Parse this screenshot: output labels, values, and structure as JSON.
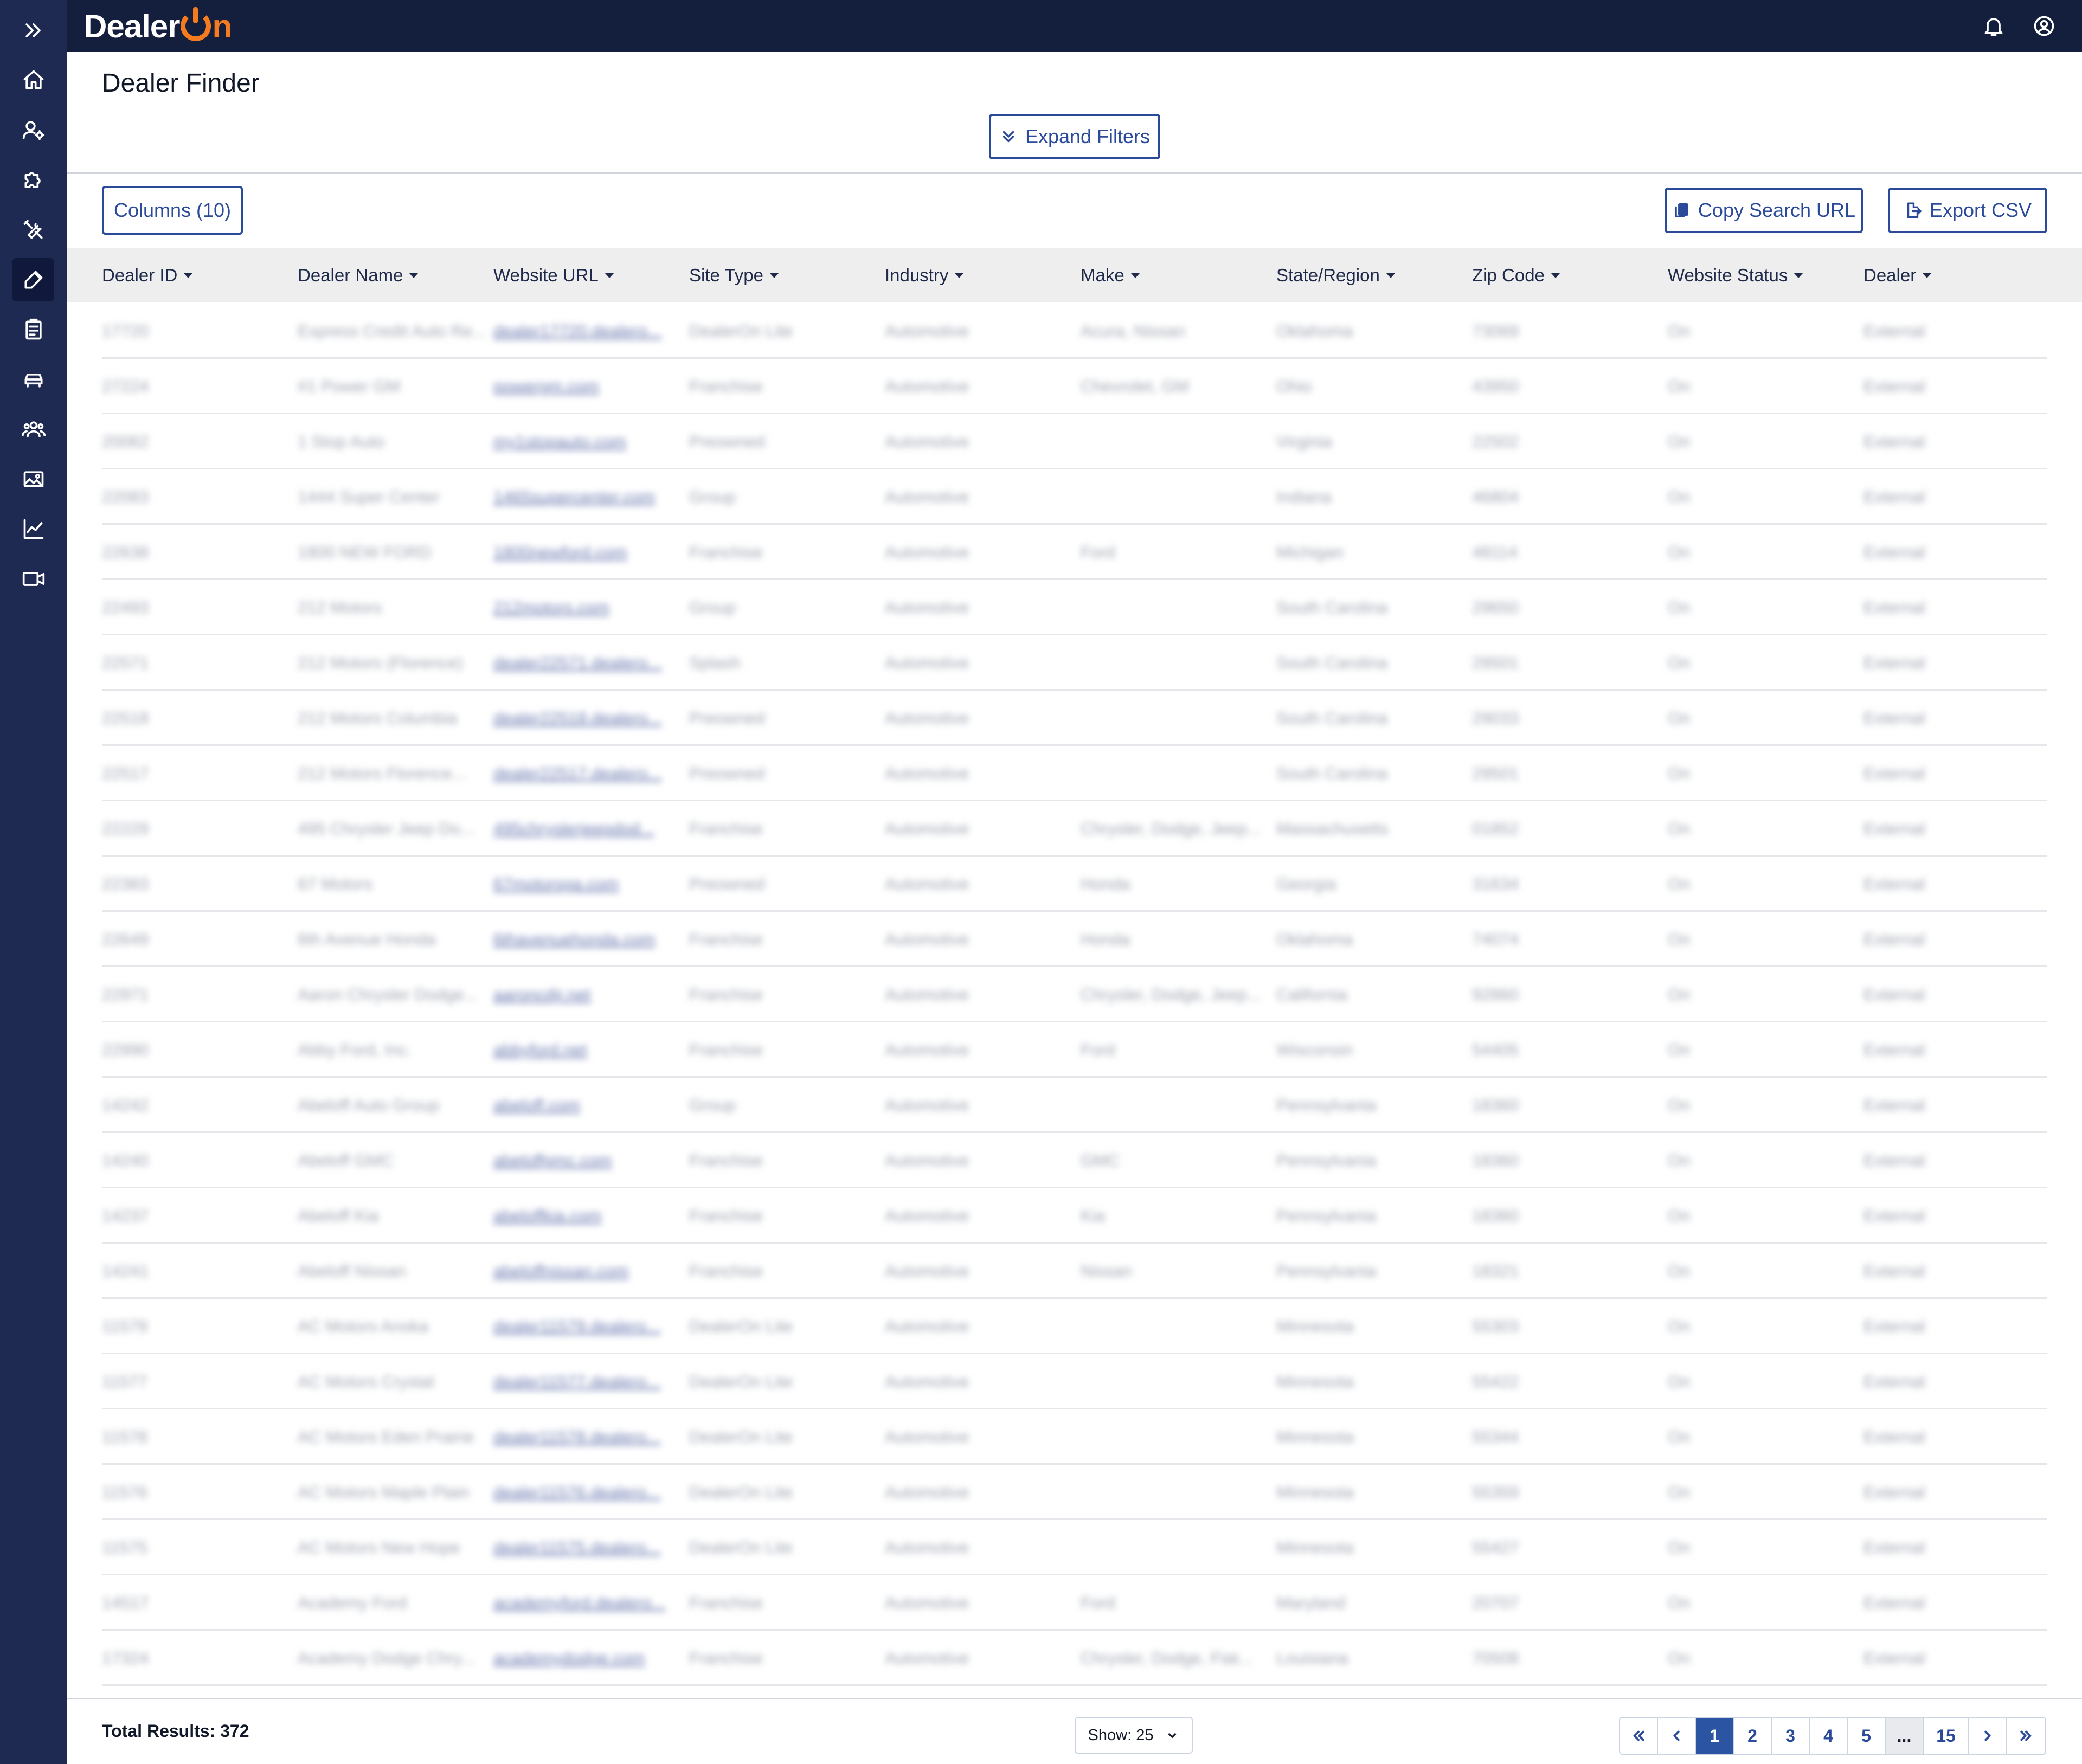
{
  "app": {
    "logo_text_1": "Dealer",
    "logo_text_2": "n"
  },
  "page": {
    "title": "Dealer Finder"
  },
  "toolbar": {
    "expand_filters": "Expand Filters",
    "columns": "Columns (10)",
    "copy_search_url": "Copy Search URL",
    "export_csv": "Export CSV"
  },
  "table": {
    "headers": [
      "Dealer ID",
      "Dealer Name",
      "Website URL",
      "Site Type",
      "Industry",
      "Make",
      "State/Region",
      "Zip Code",
      "Website Status",
      "Dealer"
    ],
    "rows": [
      [
        "17720",
        "Express Credit Auto Re...",
        "dealer17720.dealero...",
        "DealerOn Lite",
        "Automotive",
        "Acura, Nissan",
        "Oklahoma",
        "73069",
        "On",
        "External"
      ],
      [
        "27224",
        "#1 Power GM",
        "powergm.com",
        "Franchise",
        "Automotive",
        "Chevrolet, GM",
        "Ohio",
        "43950",
        "On",
        "External"
      ],
      [
        "20062",
        "1 Stop Auto",
        "my1stopauto.com",
        "Preowned",
        "Automotive",
        "",
        "Virginia",
        "22502",
        "On",
        "External"
      ],
      [
        "22083",
        "1444 Super Center",
        "1465supercenter.com",
        "Group",
        "Automotive",
        "",
        "Indiana",
        "46804",
        "On",
        "External"
      ],
      [
        "22638",
        "1800 NEW FORD",
        "1800newford.com",
        "Franchise",
        "Automotive",
        "Ford",
        "Michigan",
        "48114",
        "On",
        "External"
      ],
      [
        "22493",
        "212 Motors",
        "212motors.com",
        "Group",
        "Automotive",
        "",
        "South Carolina",
        "29650",
        "On",
        "External"
      ],
      [
        "22571",
        "212 Motors (Florence)",
        "dealer22571.dealero...",
        "Splash",
        "Automotive",
        "",
        "South Carolina",
        "29501",
        "On",
        "External"
      ],
      [
        "22518",
        "212 Motors Columbia",
        "dealer22518.dealero...",
        "Preowned",
        "Automotive",
        "",
        "South Carolina",
        "29033",
        "On",
        "External"
      ],
      [
        "22517",
        "212 Motors Florence...",
        "dealer22517.dealero...",
        "Preowned",
        "Automotive",
        "",
        "South Carolina",
        "29501",
        "On",
        "External"
      ],
      [
        "22229",
        "495 Chrysler Jeep Do...",
        "495chryslerjeepdod...",
        "Franchise",
        "Automotive",
        "Chrysler, Dodge, Jeep...",
        "Massachusetts",
        "01852",
        "On",
        "External"
      ],
      [
        "22383",
        "67 Motors",
        "67motorsga.com",
        "Preowned",
        "Automotive",
        "Honda",
        "Georgia",
        "31634",
        "On",
        "External"
      ],
      [
        "22649",
        "6th Avenue Honda",
        "6thavenuehonda.com",
        "Franchise",
        "Automotive",
        "Honda",
        "Oklahoma",
        "74074",
        "On",
        "External"
      ],
      [
        "22971",
        "Aaron Chrysler Dodge...",
        "aaroncdjr.net",
        "Franchise",
        "Automotive",
        "Chrysler, Dodge, Jeep...",
        "California",
        "92860",
        "On",
        "External"
      ],
      [
        "22990",
        "Abby Ford, Inc.",
        "abbyford.net",
        "Franchise",
        "Automotive",
        "Ford",
        "Wisconsin",
        "54405",
        "On",
        "External"
      ],
      [
        "14242",
        "Abeloff Auto Group",
        "abeloff.com",
        "Group",
        "Automotive",
        "",
        "Pennsylvania",
        "18360",
        "On",
        "External"
      ],
      [
        "14240",
        "Abeloff GMC",
        "abeloffgmc.com",
        "Franchise",
        "Automotive",
        "GMC",
        "Pennsylvania",
        "18360",
        "On",
        "External"
      ],
      [
        "14237",
        "Abeloff Kia",
        "abeloffkia.com",
        "Franchise",
        "Automotive",
        "Kia",
        "Pennsylvania",
        "18360",
        "On",
        "External"
      ],
      [
        "14241",
        "Abeloff Nissan",
        "abeloffnissan.com",
        "Franchise",
        "Automotive",
        "Nissan",
        "Pennsylvania",
        "18321",
        "On",
        "External"
      ],
      [
        "11579",
        "AC Motors Anoka",
        "dealer11579.dealero...",
        "DealerOn Lite",
        "Automotive",
        "",
        "Minnesota",
        "55303",
        "On",
        "External"
      ],
      [
        "11577",
        "AC Motors Crystal",
        "dealer11577.dealero...",
        "DealerOn Lite",
        "Automotive",
        "",
        "Minnesota",
        "55422",
        "On",
        "External"
      ],
      [
        "11578",
        "AC Motors Eden Prairie",
        "dealer11578.dealero...",
        "DealerOn Lite",
        "Automotive",
        "",
        "Minnesota",
        "55344",
        "On",
        "External"
      ],
      [
        "11576",
        "AC Motors Maple Plain",
        "dealer11576.dealero...",
        "DealerOn Lite",
        "Automotive",
        "",
        "Minnesota",
        "55359",
        "On",
        "External"
      ],
      [
        "11575",
        "AC Motors New Hope",
        "dealer11575.dealero...",
        "DealerOn Lite",
        "Automotive",
        "",
        "Minnesota",
        "55427",
        "On",
        "External"
      ],
      [
        "14517",
        "Academy Ford",
        "academyford.dealero...",
        "Franchise",
        "Automotive",
        "Ford",
        "Maryland",
        "20707",
        "On",
        "External"
      ],
      [
        "17324",
        "Academy Dodge Chry...",
        "academydodge.com",
        "Franchise",
        "Automotive",
        "Chrysler, Dodge, Fiat...",
        "Louisiana",
        "70508",
        "On",
        "External"
      ]
    ]
  },
  "footer": {
    "total_results": "Total Results: 372",
    "show": "Show: 25",
    "pages": [
      "1",
      "2",
      "3",
      "4",
      "5",
      "...",
      "15"
    ],
    "current_page": "1"
  },
  "icons": {
    "sidebar": [
      "double-chevron-right-icon",
      "home-icon",
      "user-settings-icon",
      "puzzle-icon",
      "tools-icon",
      "edit-icon",
      "clipboard-icon",
      "car-icon",
      "users-icon",
      "image-icon",
      "chart-line-icon",
      "video-icon"
    ],
    "top": [
      "bell-icon",
      "account-icon"
    ]
  },
  "colors": {
    "sidebar": "#1e2a52",
    "topbar": "#141e3d",
    "accent": "#2b4a99",
    "brand_orange": "#f47b20"
  }
}
